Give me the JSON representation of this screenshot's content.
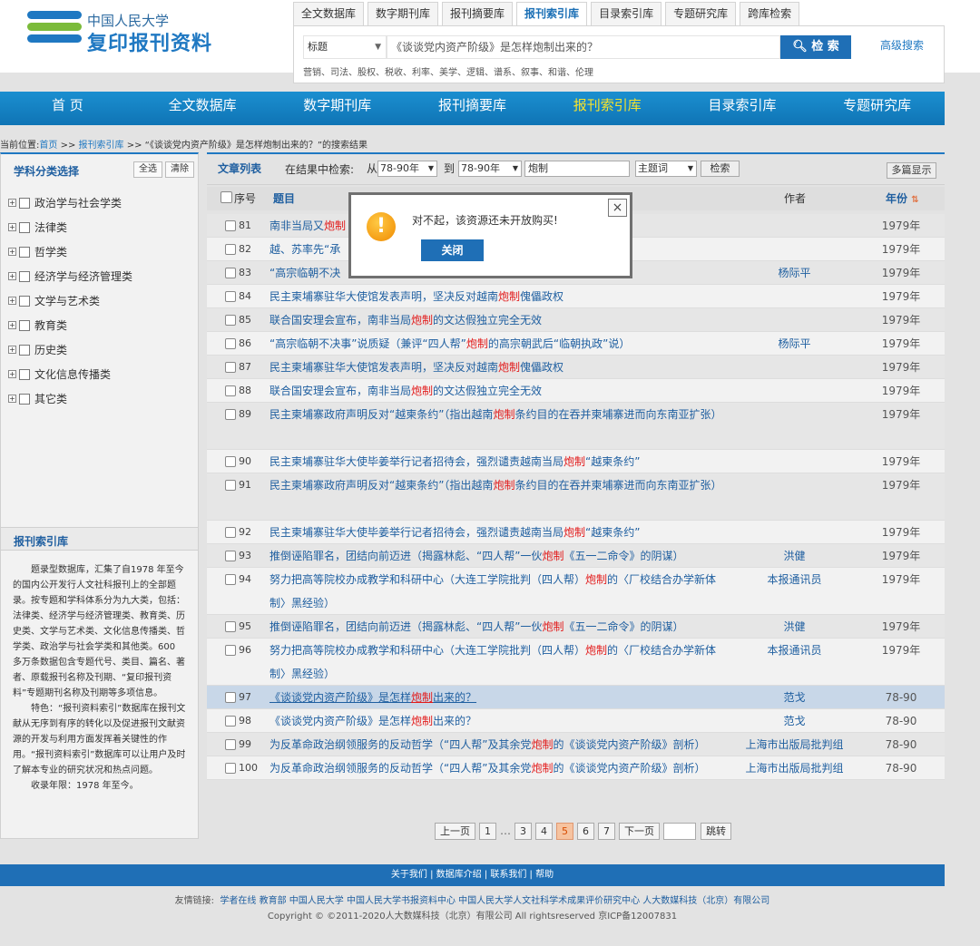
{
  "logo": {
    "top": "中国人民大学",
    "main": "复印报刊资料"
  },
  "tabs": [
    "全文数据库",
    "数字期刊库",
    "报刊摘要库",
    "报刊索引库",
    "目录索引库",
    "专题研究库",
    "跨库检索"
  ],
  "search": {
    "field": "标题",
    "query": "《谈谈党内资产阶级》是怎样炮制出来的？",
    "button": "检 索",
    "advanced": "高级搜索",
    "hot": "营销、司法、股权、税收、利率、美学、逻辑、谱系、叙事、和谐、伦理"
  },
  "nav": [
    "首 页",
    "全文数据库",
    "数字期刊库",
    "报刊摘要库",
    "报刊索引库",
    "目录索引库",
    "专题研究库"
  ],
  "breadcrumb": {
    "prefix": "当前位置:",
    "home": "首页",
    "sep1": ">>",
    "lib": "报刊索引库",
    "sep2": ">>",
    "rest": "“《谈谈党内资产阶级》是怎样炮制出来的？”的搜索结果"
  },
  "sidebar": {
    "title": "学科分类选择",
    "select_all": "全选",
    "clear": "清除",
    "categories": [
      "政治学与社会学类",
      "法律类",
      "哲学类",
      "经济学与经济管理类",
      "文学与艺术类",
      "教育类",
      "历史类",
      "文化信息传播类",
      "其它类"
    ],
    "index_title": "报刊索引库",
    "desc1": "题录型数据库，汇集了自1978 年至今的国内公开发行人文社科报刊上的全部题录。按专题和学科体系分为九大类，包括：法律类、经济学与经济管理类、教育类、历史类、文学与艺术类、文化信息传播类、哲学类、政治学与社会学类和其他类。600 多万条数据包含专题代号、类目、篇名、著者、原载报刊名称及刊期、“复印报刊资料”专题期刊名称及刊期等多项信息。",
    "desc2": "特色：“报刊资料索引”数据库在报刊文献从无序到有序的转化以及促进报刊文献资源的开发与利用方面发挥着关键性的作用。“报刊资料索引”数据库可以让用户及时了解本专业的研究状况和热点问题。",
    "desc3": "收录年限：1978 年至今。"
  },
  "toolbar": {
    "title": "文章列表",
    "label": "在结果中检索:",
    "from": "从",
    "from_val": "78-90年",
    "to": "到",
    "to_val": "78-90年",
    "input": "炮制",
    "field": "主题词",
    "btn": "检索",
    "multi": "多篇显示"
  },
  "table_head": {
    "no": "序号",
    "title": "题目",
    "author": "作者",
    "year": "年份"
  },
  "rows": [
    {
      "no": "81",
      "title": "南非当局又炮制",
      "author": "",
      "year": "1979年"
    },
    {
      "no": "82",
      "title": "越、苏率先“承",
      "author": "",
      "year": "1979年"
    },
    {
      "no": "83",
      "title": "“高宗临朝不决",
      "tail": "”说）",
      "author": "杨际平",
      "year": "1979年"
    },
    {
      "no": "84",
      "title": "民主柬埔寨驻华大使馆发表声明，坚决反对越南炮制傀儡政权",
      "author": "",
      "year": "1979年"
    },
    {
      "no": "85",
      "title": "联合国安理会宣布，南非当局炮制的文达假独立完全无效",
      "author": "",
      "year": "1979年"
    },
    {
      "no": "86",
      "title": "“高宗临朝不决事”说质疑（兼评“四人帮”炮制的高宗朝武后“临朝执政”说）",
      "author": "杨际平",
      "year": "1979年"
    },
    {
      "no": "87",
      "title": "民主柬埔寨驻华大使馆发表声明，坚决反对越南炮制傀儡政权",
      "author": "",
      "year": "1979年"
    },
    {
      "no": "88",
      "title": "联合国安理会宣布，南非当局炮制的文达假独立完全无效",
      "author": "",
      "year": "1979年"
    },
    {
      "no": "89",
      "title": "民主柬埔寨政府声明反对“越柬条约”（指出越南炮制条约目的在吞并柬埔寨进而向东南亚扩张）",
      "author": "",
      "year": "1979年"
    },
    {
      "no": "90",
      "title": "民主柬埔寨驻华大使毕姜举行记者招待会，强烈谴责越南当局炮制“越柬条约”",
      "author": "",
      "year": "1979年"
    },
    {
      "no": "91",
      "title": "民主柬埔寨政府声明反对“越柬条约”（指出越南炮制条约目的在吞并柬埔寨进而向东南亚扩张）",
      "author": "",
      "year": "1979年"
    },
    {
      "no": "92",
      "title": "民主柬埔寨驻华大使毕姜举行记者招待会，强烈谴责越南当局炮制“越柬条约”",
      "author": "",
      "year": "1979年"
    },
    {
      "no": "93",
      "title": "推倒诬陷罪名，团结向前迈进（揭露林彪、“四人帮”一伙炮制《五一二命令》的阴谋）",
      "author": "洪健",
      "year": "1979年"
    },
    {
      "no": "94",
      "title": "努力把高等院校办成教学和科研中心（大连工学院批判（四人帮）炮制的〈厂校结合办学新体制〉黑经验）",
      "author": "本报通讯员",
      "year": "1979年"
    },
    {
      "no": "95",
      "title": "推倒诬陷罪名，团结向前迈进（揭露林彪、“四人帮”一伙炮制《五一二命令》的阴谋）",
      "author": "洪健",
      "year": "1979年"
    },
    {
      "no": "96",
      "title": "努力把高等院校办成教学和科研中心（大连工学院批判（四人帮）炮制的〈厂校结合办学新体制〉黑经验）",
      "author": "本报通讯员",
      "year": "1979年"
    },
    {
      "no": "97",
      "title": "《谈谈党内资产阶级》是怎样炮制出来的？",
      "author": "范戈",
      "year": "78-90"
    },
    {
      "no": "98",
      "title": "《谈谈党内资产阶级》是怎样炮制出来的？",
      "author": "范戈",
      "year": "78-90"
    },
    {
      "no": "99",
      "title": "为反革命政治纲领服务的反动哲学（“四人帮”及其余党炮制的《谈谈党内资产阶级》剖析）",
      "author": "上海市出版局批判组",
      "year": "78-90"
    },
    {
      "no": "100",
      "title": "为反革命政治纲领服务的反动哲学（“四人帮”及其余党炮制的《谈谈党内资产阶级》剖析）",
      "author": "上海市出版局批判组",
      "year": "78-90"
    }
  ],
  "pager": {
    "prev": "上一页",
    "pages": [
      "1",
      "3",
      "4",
      "5",
      "6",
      "7"
    ],
    "dots": "…",
    "current": "5",
    "next": "下一页",
    "jump": "跳转"
  },
  "footer": {
    "links": "关于我们 | 数据库介绍 | 联系我们 | 帮助",
    "friend_label": "友情链接:",
    "friends": "学者在线 教育部 中国人民大学 中国人民大学书报资料中心 中国人民大学人文社科学术成果评价研究中心 人大数媒科技（北京）有限公司",
    "copyright": "Copyright © ©2011-2020人大数媒科技（北京）有限公司 All rightsreserved 京ICP备12007831"
  },
  "dialog": {
    "message": "对不起，该资源还未开放购买!",
    "button": "关闭",
    "close": "×",
    "icon": "!"
  },
  "colors": {
    "brand": "#1f6fb6",
    "highlight": "#e21b1b",
    "nav_active": "#f6e32c"
  }
}
